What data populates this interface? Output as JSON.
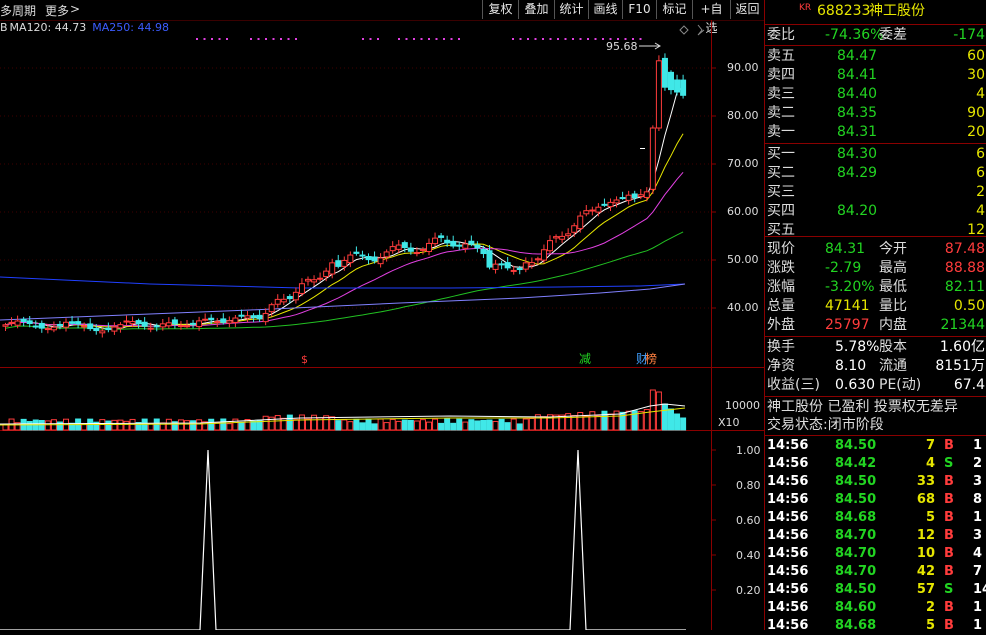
{
  "topbar": {
    "period_label": "多周期",
    "more_label": "更多",
    "more_arrow": ">",
    "buttons": [
      "复权",
      "叠加",
      "统计",
      "画线",
      "F10",
      "标记",
      "+自选",
      "返回"
    ]
  },
  "legend": {
    "prefix": "B",
    "ma120": "MA120: 44.73",
    "ma250": "MA250: 44.98"
  },
  "price_axis": [
    "90.00",
    "80.00",
    "70.00",
    "60.00",
    "50.00",
    "40.00"
  ],
  "peak_label": "95.68",
  "markers": {
    "s": "$",
    "jian": "减",
    "cai": "财",
    "bang": "榜"
  },
  "volume_axis": {
    "value": "10000",
    "unit": "X10"
  },
  "indicator_axis": [
    "1.00",
    "0.80",
    "0.60",
    "0.40",
    "0.20"
  ],
  "stock": {
    "kr": "KR",
    "code": "688233",
    "name": "神工股份"
  },
  "order_ratio": {
    "label1": "委比",
    "value1": "-74.36%",
    "label2": "委差",
    "value2": "-174"
  },
  "asks": [
    {
      "label": "卖五",
      "price": "84.47",
      "vol": "60"
    },
    {
      "label": "卖四",
      "price": "84.41",
      "vol": "30"
    },
    {
      "label": "卖三",
      "price": "84.40",
      "vol": "4"
    },
    {
      "label": "卖二",
      "price": "84.35",
      "vol": "90"
    },
    {
      "label": "卖一",
      "price": "84.31",
      "vol": "20"
    }
  ],
  "bids": [
    {
      "label": "买一",
      "price": "84.30",
      "vol": "6"
    },
    {
      "label": "买二",
      "price": "84.29",
      "vol": "6"
    },
    {
      "label": "买三",
      "price": "",
      "vol": "2"
    },
    {
      "label": "买四",
      "price": "84.20",
      "vol": "4"
    },
    {
      "label": "买五",
      "price": "",
      "vol": "12"
    }
  ],
  "quote": [
    {
      "l1": "现价",
      "v1": "84.31",
      "c1": "grn",
      "l2": "今开",
      "v2": "87.48",
      "c2": "red"
    },
    {
      "l1": "涨跌",
      "v1": "-2.79",
      "c1": "grn",
      "l2": "最高",
      "v2": "88.88",
      "c2": "red"
    },
    {
      "l1": "涨幅",
      "v1": "-3.20%",
      "c1": "grn",
      "l2": "最低",
      "v2": "82.11",
      "c2": "grn"
    },
    {
      "l1": "总量",
      "v1": "47141",
      "c1": "yel",
      "l2": "量比",
      "v2": "0.50",
      "c2": "yel"
    },
    {
      "l1": "外盘",
      "v1": "25797",
      "c1": "red",
      "l2": "内盘",
      "v2": "21344",
      "c2": "grn"
    }
  ],
  "fundamentals": [
    {
      "l1": "换手",
      "v1": "5.78%",
      "l2": "股本",
      "v2": "1.60亿"
    },
    {
      "l1": "净资",
      "v1": "8.10",
      "l2": "流通",
      "v2": "8151万"
    },
    {
      "l1": "收益(三)",
      "v1": "0.630",
      "l2": "PE(动)",
      "v2": "67.4"
    }
  ],
  "status_line1": "神工股份 已盈利 投票权无差异",
  "status_line2": "交易状态:闭市阶段",
  "trades": [
    {
      "time": "14:56",
      "price": "84.50",
      "vol": "7",
      "side": "B",
      "n": "1"
    },
    {
      "time": "14:56",
      "price": "84.42",
      "vol": "4",
      "side": "S",
      "n": "2"
    },
    {
      "time": "14:56",
      "price": "84.50",
      "vol": "33",
      "side": "B",
      "n": "3"
    },
    {
      "time": "14:56",
      "price": "84.50",
      "vol": "68",
      "side": "B",
      "n": "8"
    },
    {
      "time": "14:56",
      "price": "84.68",
      "vol": "5",
      "side": "B",
      "n": "1"
    },
    {
      "time": "14:56",
      "price": "84.70",
      "vol": "12",
      "side": "B",
      "n": "3"
    },
    {
      "time": "14:56",
      "price": "84.70",
      "vol": "10",
      "side": "B",
      "n": "4"
    },
    {
      "time": "14:56",
      "price": "84.70",
      "vol": "42",
      "side": "B",
      "n": "7"
    },
    {
      "time": "14:56",
      "price": "84.50",
      "vol": "57",
      "side": "S",
      "n": "14"
    },
    {
      "time": "14:56",
      "price": "84.60",
      "vol": "2",
      "side": "B",
      "n": "1"
    },
    {
      "time": "14:56",
      "price": "84.68",
      "vol": "5",
      "side": "B",
      "n": "1"
    }
  ],
  "colors": {
    "up": "#ff3c3c",
    "down": "#40e8e8",
    "ma5": "#ffffff",
    "ma10": "#e6e600",
    "ma20": "#e040e0",
    "ma60": "#22c022",
    "ma120": "#2040ff",
    "ma250": "#8080ff",
    "grid": "#8a0000"
  }
}
